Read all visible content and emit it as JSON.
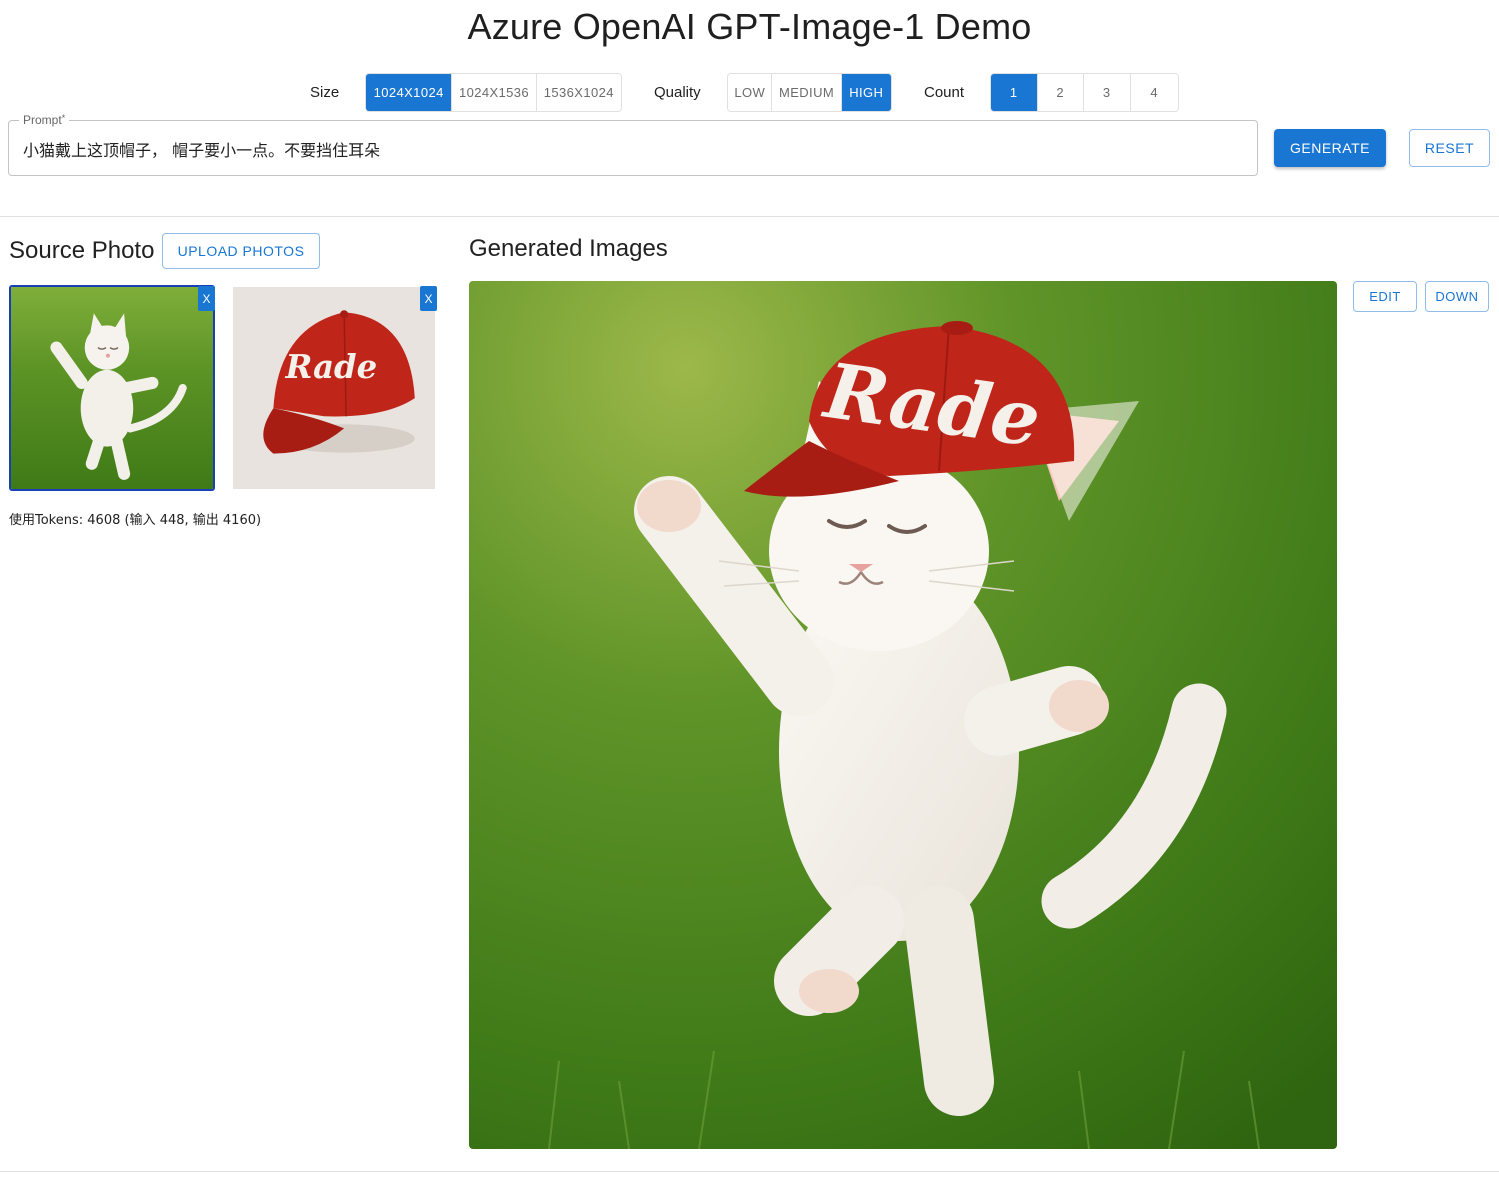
{
  "app": {
    "title": "Azure OpenAI GPT-Image-1 Demo"
  },
  "controls": {
    "size": {
      "label": "Size",
      "options": [
        "1024X1024",
        "1024X1536",
        "1536X1024"
      ],
      "selected": "1024X1024"
    },
    "quality": {
      "label": "Quality",
      "options": [
        "LOW",
        "MEDIUM",
        "HIGH"
      ],
      "selected": "HIGH"
    },
    "count": {
      "label": "Count",
      "options": [
        "1",
        "2",
        "3",
        "4"
      ],
      "selected": "1"
    }
  },
  "prompt": {
    "label": "Prompt",
    "required_mark": "*",
    "value": "小猫戴上这顶帽子， 帽子要小一点。不要挡住耳朵"
  },
  "actions": {
    "generate_label": "GENERATE",
    "reset_label": "RESET"
  },
  "source": {
    "title": "Source Photo",
    "upload_label": "UPLOAD PHOTOS",
    "remove_label": "X",
    "photos": [
      {
        "name": "kitten-photo",
        "selected": true
      },
      {
        "name": "red-cap-photo",
        "selected": false,
        "cap_text": "Rade"
      }
    ],
    "tokens_text": "使用Tokens: 4608 (输入 448, 输出 4160)"
  },
  "generated": {
    "title": "Generated Images",
    "cap_text": "Rade",
    "edit_label": "EDIT",
    "download_label": "DOWN"
  },
  "colors": {
    "primary": "#1976d2",
    "selected_border": "#1740b8",
    "cap_red": "#c0251a",
    "grass_green": "#4f8a1e"
  }
}
